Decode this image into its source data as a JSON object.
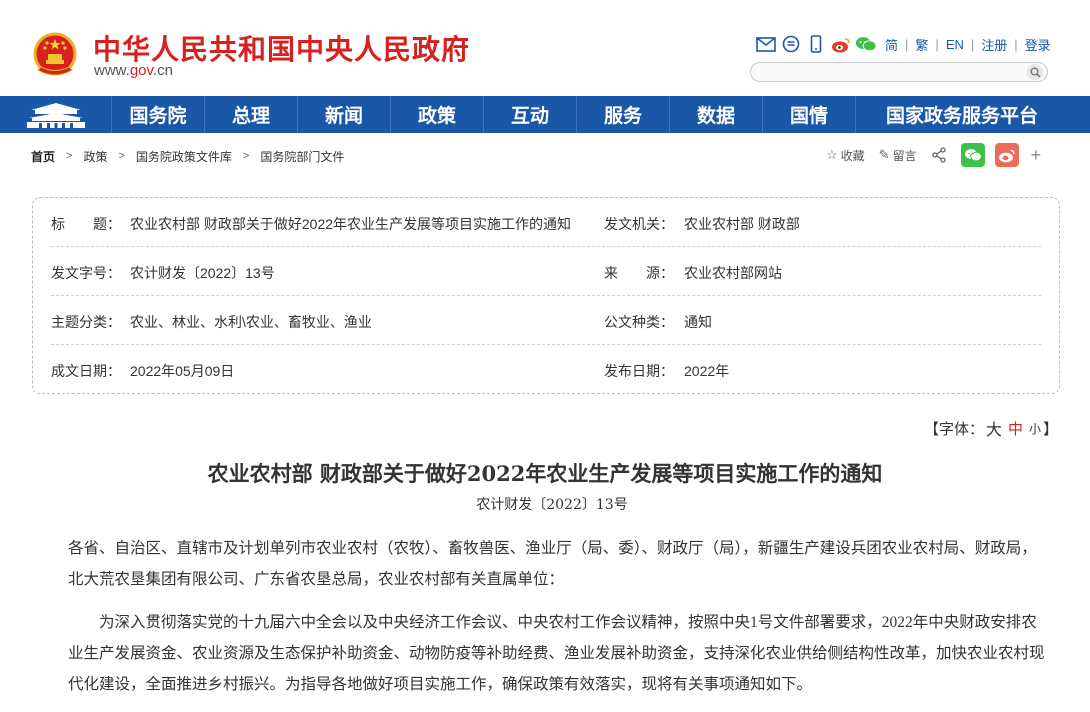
{
  "header": {
    "site_title": "中华人民共和国中央人民政府",
    "site_url_prefix": "www.",
    "site_url_highlight": "gov",
    "site_url_suffix": ".cn",
    "icons": [
      "mail-icon",
      "message-icon",
      "mobile-icon",
      "weibo-icon",
      "wechat-icon"
    ],
    "links": [
      "简",
      "繁",
      "EN",
      "注册",
      "登录"
    ],
    "search_placeholder": ""
  },
  "nav": {
    "items": [
      "国务院",
      "总理",
      "新闻",
      "政策",
      "互动",
      "服务",
      "数据",
      "国情",
      "国家政务服务平台"
    ]
  },
  "breadcrumb": {
    "items": [
      "首页",
      "政策",
      "国务院政策文件库",
      "国务院部门文件"
    ],
    "separator": ">"
  },
  "share": {
    "favorite_label": "收藏",
    "comment_label": "留言",
    "plus": "+"
  },
  "meta": {
    "rows": [
      {
        "l_label": "标　　题：",
        "l_value": "农业农村部 财政部关于做好2022年农业生产发展等项目实施工作的通知",
        "r_label": "发文机关：",
        "r_value": "农业农村部 财政部"
      },
      {
        "l_label": "发文字号：",
        "l_value": "农计财发〔2022〕13号",
        "r_label": "来　　源：",
        "r_value": "农业农村部网站"
      },
      {
        "l_label": "主题分类：",
        "l_value": "农业、林业、水利\\农业、畜牧业、渔业",
        "r_label": "公文种类：",
        "r_value": "通知"
      },
      {
        "l_label": "成文日期：",
        "l_value": "2022年05月09日",
        "r_label": "发布日期：",
        "r_value": "2022年"
      }
    ]
  },
  "font_control": {
    "prefix": "【字体：",
    "big": "大",
    "mid": "中",
    "small": "小",
    "suffix": "】"
  },
  "article": {
    "title": "农业农村部 财政部关于做好2022年农业生产发展等项目实施工作的通知",
    "doc_no": "农计财发〔2022〕13号",
    "p1": "各省、自治区、直辖市及计划单列市农业农村（农牧）、畜牧兽医、渔业厅（局、委）、财政厅（局），新疆生产建设兵团农业农村局、财政局，北大荒农垦集团有限公司、广东省农垦总局，农业农村部有关直属单位：",
    "p2": "为深入贯彻落实党的十九届六中全会以及中央经济工作会议、中央农村工作会议精神，按照中央1号文件部署要求，2022年中央财政安排农业生产发展资金、农业资源及生态保护补助资金、动物防疫等补助经费、渔业发展补助资金，支持深化农业供给侧结构性改革，加快农业农村现代化建设，全面推进乡村振兴。为指导各地做好项目实施工作，确保政策有效落实，现将有关事项通知如下。"
  },
  "colors": {
    "brand_red": "#d8201f",
    "nav_blue": "#1a57a6"
  }
}
